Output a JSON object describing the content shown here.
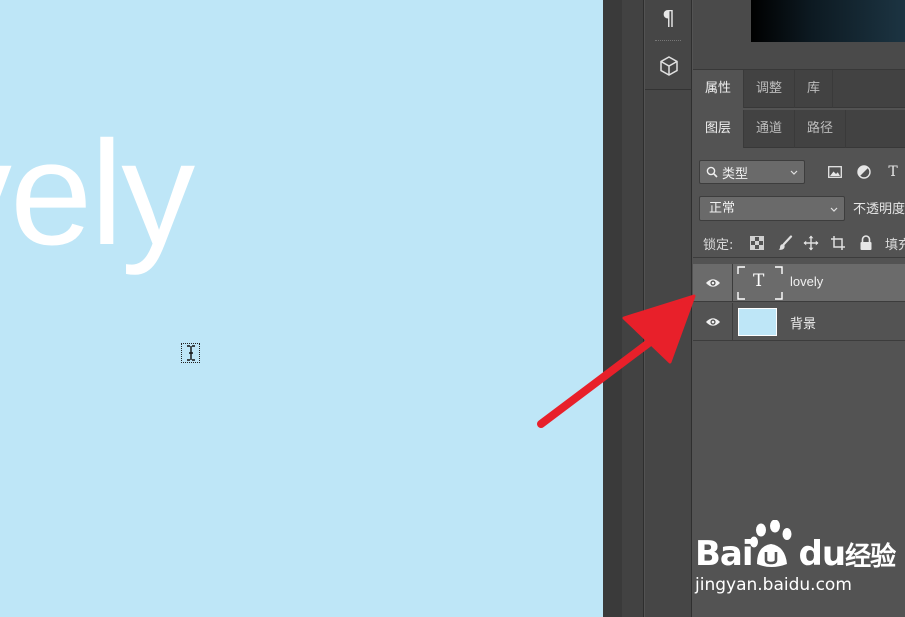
{
  "canvas": {
    "text": "vely",
    "background": "#bee6f7"
  },
  "toolbar": {
    "paragraph_icon": "¶"
  },
  "panel": {
    "top_tabs": [
      {
        "label": "属性",
        "active": true
      },
      {
        "label": "调整",
        "active": false
      },
      {
        "label": "库",
        "active": false
      }
    ],
    "layer_tabs": [
      {
        "label": "图层",
        "active": true
      },
      {
        "label": "通道",
        "active": false
      },
      {
        "label": "路径",
        "active": false
      }
    ],
    "filter": {
      "label": "类型",
      "icons": [
        "image-filter-icon",
        "adjustment-filter-icon",
        "type-filter-icon"
      ],
      "type_glyph": "T"
    },
    "blend_mode": "正常",
    "opacity_label": "不透明度",
    "lock_label": "锁定:",
    "fill_label": "填充",
    "layers": [
      {
        "name": "lovely",
        "kind": "text",
        "selected": true,
        "thumb_glyph": "T"
      },
      {
        "name": "背景",
        "kind": "background",
        "selected": false
      }
    ]
  },
  "watermark": {
    "brand_latin_1": "Bai",
    "brand_latin_2": "du",
    "brand_cn": "经验",
    "url": "jingyan.baidu.com"
  },
  "annotation": {
    "arrow_color": "#e8202a"
  }
}
